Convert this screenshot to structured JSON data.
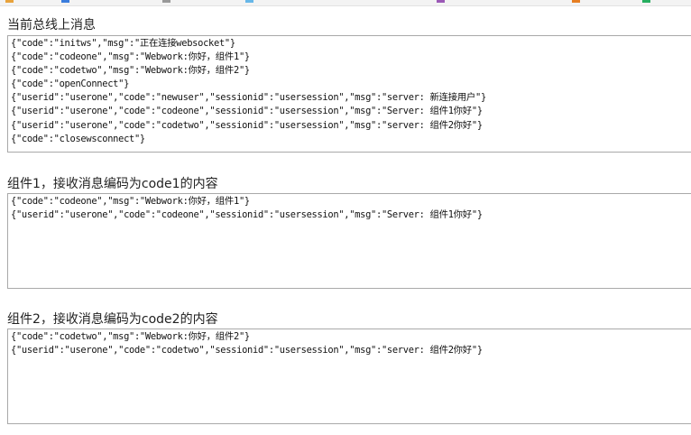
{
  "bookmarks": [
    {
      "label": "",
      "icon": "folder-icon",
      "color": "#e8a33c"
    },
    {
      "label": "",
      "icon": "page-icon",
      "color": "#3b7ddd"
    },
    {
      "label": "",
      "icon": "page-icon",
      "color": "#999999"
    },
    {
      "label": "",
      "icon": "page-icon",
      "color": "#67b7e8"
    },
    {
      "label": "",
      "icon": "page-icon",
      "color": "#9b59b6"
    },
    {
      "label": "",
      "icon": "page-icon",
      "color": "#e67e22"
    },
    {
      "label": "",
      "icon": "page-icon",
      "color": "#27ae60"
    }
  ],
  "sections": [
    {
      "title": "当前总线上消息",
      "messages": [
        "{\"code\":\"initws\",\"msg\":\"正在连接websocket\"}",
        "{\"code\":\"codeone\",\"msg\":\"Webwork:你好，组件1\"}",
        "{\"code\":\"codetwo\",\"msg\":\"Webwork:你好，组件2\"}",
        "{\"code\":\"openConnect\"}",
        "{\"userid\":\"userone\",\"code\":\"newuser\",\"sessionid\":\"usersession\",\"msg\":\"server: 新连接用户\"}",
        "{\"userid\":\"userone\",\"code\":\"codeone\",\"sessionid\":\"usersession\",\"msg\":\"Server: 组件1你好\"}",
        "{\"userid\":\"userone\",\"code\":\"codetwo\",\"sessionid\":\"usersession\",\"msg\":\"server: 组件2你好\"}",
        "{\"code\":\"closewsconnect\"}"
      ]
    },
    {
      "title": "组件1，接收消息编码为code1的内容",
      "messages": [
        "{\"code\":\"codeone\",\"msg\":\"Webwork:你好，组件1\"}",
        "{\"userid\":\"userone\",\"code\":\"codeone\",\"sessionid\":\"usersession\",\"msg\":\"Server: 组件1你好\"}"
      ]
    },
    {
      "title": "组件2，接收消息编码为code2的内容",
      "messages": [
        "{\"code\":\"codetwo\",\"msg\":\"Webwork:你好，组件2\"}",
        "{\"userid\":\"userone\",\"code\":\"codetwo\",\"sessionid\":\"usersession\",\"msg\":\"server: 组件2你好\"}"
      ]
    }
  ]
}
